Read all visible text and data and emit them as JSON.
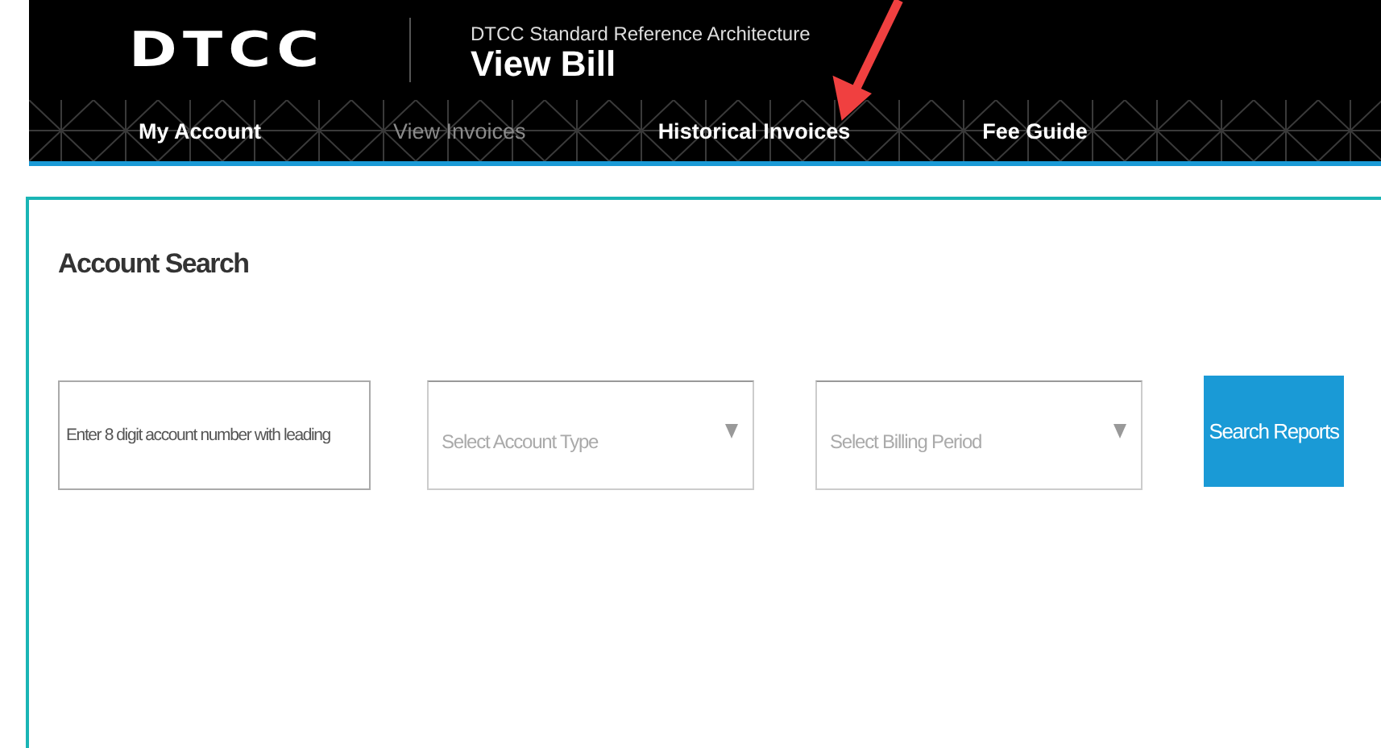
{
  "header": {
    "logo": "DTCC",
    "subtitle": "DTCC Standard Reference Architecture",
    "title": "View Bill"
  },
  "nav": [
    {
      "label": "My Account",
      "selected": false
    },
    {
      "label": "View Invoices",
      "selected": true
    },
    {
      "label": "Historical Invoices",
      "selected": false
    },
    {
      "label": "Fee Guide",
      "selected": false
    }
  ],
  "search": {
    "heading": "Account Search",
    "account_field": {
      "placeholder": "Enter 8 digit account number with leading"
    },
    "selects": [
      {
        "placeholder": "Select Account Type"
      },
      {
        "placeholder": "Select Billing Period"
      }
    ],
    "button": "Search Reports"
  }
}
